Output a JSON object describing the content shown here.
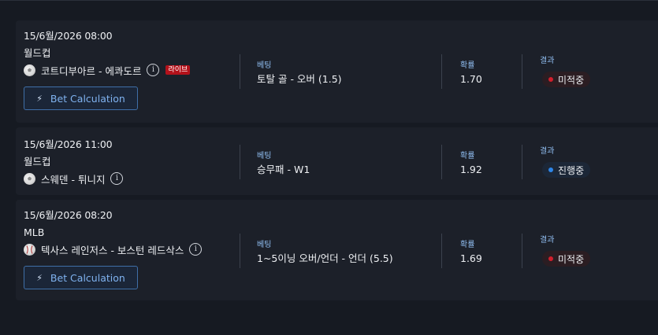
{
  "bets": [
    {
      "date": "15/6월/2026 08:00",
      "league": "월드컵",
      "teams": "코트디부아르 - 에콰도르",
      "live_label": "라이브",
      "bet_label": "베팅",
      "bet_value": "토탈 골 - 오버 (1.5)",
      "odds_label": "확률",
      "odds_value": "1.70",
      "result_label": "결과",
      "status": "미적중",
      "button_label": "Bet Calculation"
    },
    {
      "date": "15/6월/2026 11:00",
      "league": "월드컵",
      "teams": "스웨덴 - 튀니지",
      "bet_label": "베팅",
      "bet_value": "승무패 - W1",
      "odds_label": "확률",
      "odds_value": "1.92",
      "result_label": "결과",
      "status": "진행중"
    },
    {
      "date": "15/6월/2026 08:20",
      "league": "MLB",
      "teams": "텍사스 레인저스 - 보스턴 레드삭스",
      "bet_label": "베팅",
      "bet_value": "1~5이닝 오버/언더 - 언더 (5.5)",
      "odds_label": "확률",
      "odds_value": "1.69",
      "result_label": "결과",
      "status": "미적중",
      "button_label": "Bet Calculation"
    }
  ],
  "icons": {
    "sport_ball": "soccer-ball-icon",
    "baseball": "baseball-icon",
    "info": "info-icon",
    "bolt": "lightning-icon"
  },
  "colors": {
    "background": "#161a22",
    "card": "#1c2029",
    "label_blue": "#8fbdf0",
    "button_border": "#3f6fa8",
    "live_red": "#b3121b",
    "status_lost_dot": "#d11f2c",
    "status_progress_dot": "#2e86e8"
  }
}
